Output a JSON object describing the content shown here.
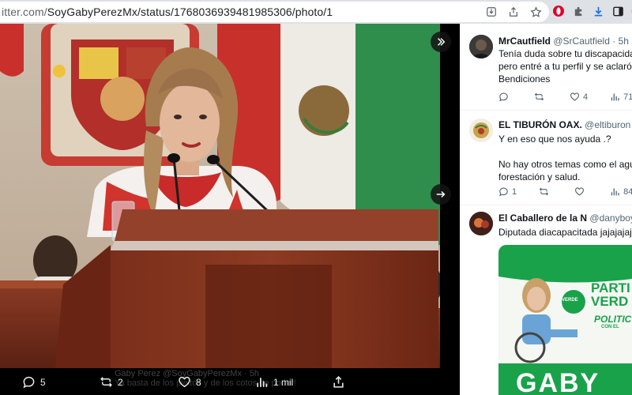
{
  "browser": {
    "url_host": "itter.com/",
    "url_path": "SoyGabyPerezMx/status/1768036939481985306/photo/1"
  },
  "viewer": {
    "actions": {
      "replies": "5",
      "reposts": "2",
      "likes": "8",
      "views": "1 mil"
    },
    "ghost_author": "Gaby Perez @SoyGabyPerezMx · 5h",
    "ghost_text": "Ya basta de los pleitos y de los cotos de poder!"
  },
  "replies": [
    {
      "name": "MrCautfield",
      "handle": "@SrCautfield · 5h",
      "lines": [
        "Tenía duda sobre tu discapacidad",
        "pero entré a tu perfil y se aclaró t",
        "Bendiciones"
      ],
      "reply_count": "",
      "repost_count": "",
      "like_count": "4",
      "view_count": "71"
    },
    {
      "name": "EL TIBURÓN OAX.",
      "handle": "@eltiburon · 1",
      "lines": [
        "Y en eso que nos ayuda .?",
        "",
        "No hay otros temas como el agua",
        "forestación y salud."
      ],
      "reply_count": "1",
      "repost_count": "",
      "like_count": "",
      "view_count": "84"
    },
    {
      "name": "El Caballero de la N",
      "handle": "@danyboys ·",
      "lines": [
        "Diputada diacapacitada jajajajaja"
      ]
    }
  ],
  "promo": {
    "party": "PARTI",
    "party2": "VERD",
    "badge": "VERDE",
    "slogan": "POLITIC",
    "slogan2": "CON EL",
    "name": "GABY"
  },
  "colors": {
    "accent_green": "#19a24a",
    "viewer_bg": "#000000",
    "text_primary": "#0f1419",
    "text_secondary": "#536471"
  }
}
